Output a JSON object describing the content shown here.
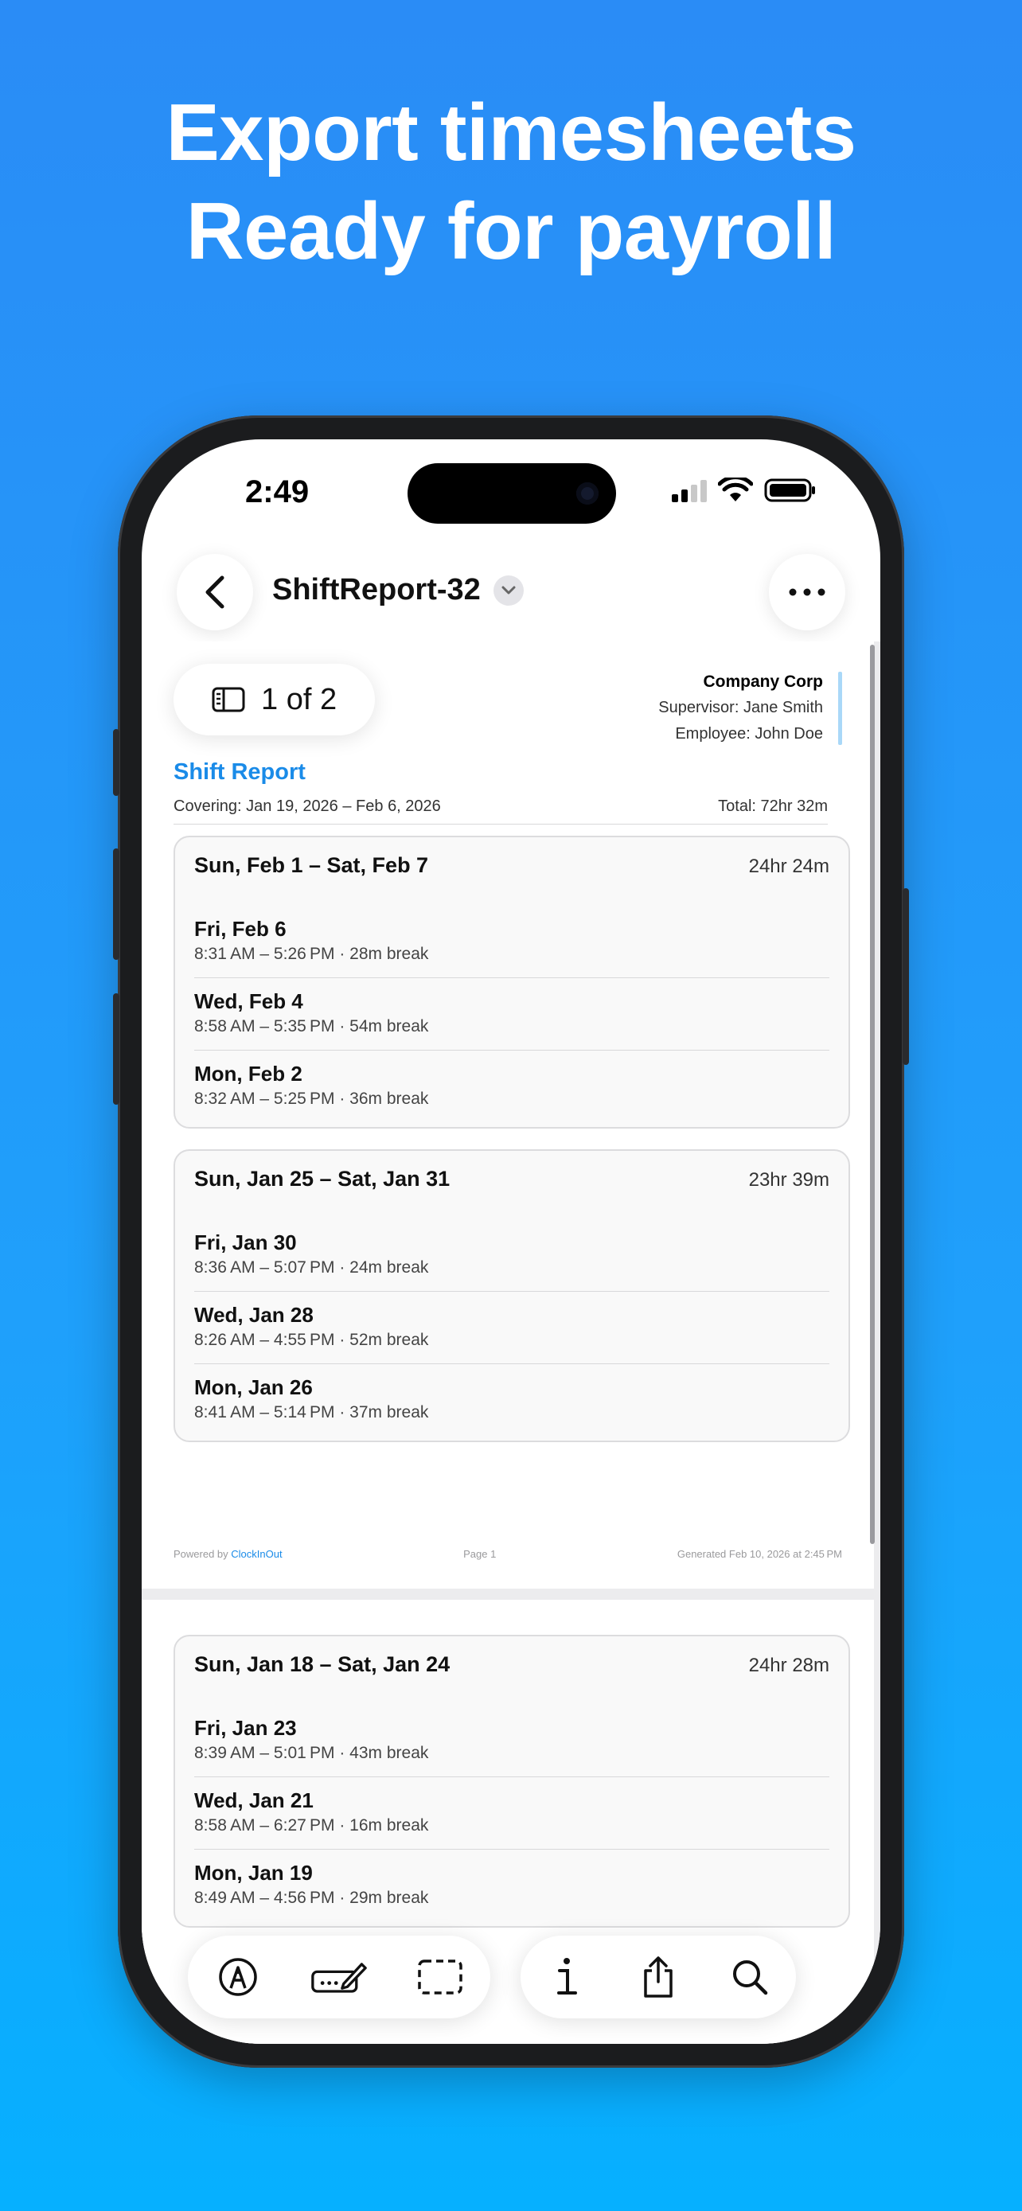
{
  "headline": {
    "line1": "Export timesheets",
    "line2": "Ready for payroll"
  },
  "status_bar": {
    "time": "2:49"
  },
  "nav": {
    "title": "ShiftReport-32"
  },
  "pager": {
    "label": "1 of 2"
  },
  "company": {
    "name": "Company Corp",
    "supervisor": "Supervisor: Jane Smith",
    "employee": "Employee: John Doe"
  },
  "report": {
    "title": "Shift Report",
    "covering": "Covering: Jan 19, 2026 – Feb 6, 2026",
    "total": "Total: 72hr 32m"
  },
  "weeks": [
    {
      "range": "Sun, Feb 1 – Sat, Feb 7",
      "total": "24hr 24m",
      "days": [
        {
          "name": "Fri, Feb 6",
          "time": "8:31 AM – 5:26 PM · 28m break"
        },
        {
          "name": "Wed, Feb 4",
          "time": "8:58 AM – 5:35 PM · 54m break"
        },
        {
          "name": "Mon, Feb 2",
          "time": "8:32 AM – 5:25 PM · 36m break"
        }
      ]
    },
    {
      "range": "Sun, Jan 25 – Sat, Jan 31",
      "total": "23hr 39m",
      "days": [
        {
          "name": "Fri, Jan 30",
          "time": "8:36 AM – 5:07 PM · 24m break"
        },
        {
          "name": "Wed, Jan 28",
          "time": "8:26 AM – 4:55 PM · 52m break"
        },
        {
          "name": "Mon, Jan 26",
          "time": "8:41 AM – 5:14 PM · 37m break"
        }
      ]
    },
    {
      "range": "Sun, Jan 18 – Sat, Jan 24",
      "total": "24hr 28m",
      "days": [
        {
          "name": "Fri, Jan 23",
          "time": "8:39 AM – 5:01 PM · 43m break"
        },
        {
          "name": "Wed, Jan 21",
          "time": "8:58 AM – 6:27 PM · 16m break"
        },
        {
          "name": "Mon, Jan 19",
          "time": "8:49 AM – 4:56 PM · 29m break"
        }
      ]
    }
  ],
  "footer": {
    "powered_prefix": "Powered by",
    "powered_brand": "ClockInOut",
    "page": "Page 1",
    "generated": "Generated Feb 10, 2026 at 2:45 PM"
  },
  "colors": {
    "background": "#1fa0fb",
    "accent": "#1a8be8"
  },
  "icons": {
    "nav": [
      "back-chevron-icon",
      "chevron-down-icon",
      "more-icon"
    ],
    "toolbar": [
      "markup-pen-icon",
      "signature-icon",
      "selection-icon",
      "info-icon",
      "share-icon",
      "search-icon"
    ]
  }
}
